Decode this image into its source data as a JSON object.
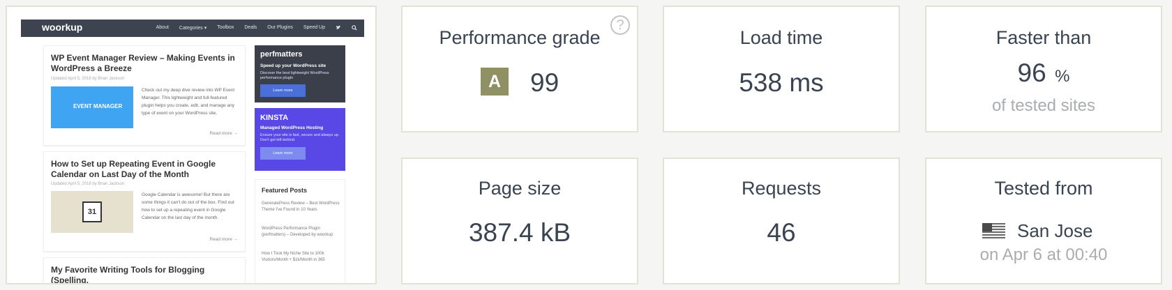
{
  "screenshot": {
    "logo": "woorkup",
    "nav": [
      "About",
      "Categories ▾",
      "Toolbox",
      "Deals",
      "Our Plugins",
      "Speed Up"
    ],
    "posts": [
      {
        "title": "WP Event Manager Review – Making Events in WordPress a Breeze",
        "meta": "Updated April 5, 2018 by Brian Jackson",
        "image_label": "EVENT MANAGER",
        "excerpt": "Check out my deep dive review into WP Event Manager. This lightweight and full-featured plugin helps you create, edit, and manage any type of event on your WordPress site.",
        "read_more": "Read more →"
      },
      {
        "title": "How to Set up Repeating Event in Google Calendar on Last Day of the Month",
        "meta": "Updated April 5, 2018 by Brian Jackson",
        "image_label": "31",
        "excerpt": "Google Calendar is awesome! But there are some things it can't do out of the box. Find out how to set up a repeating event in Google Calendar on the last day of the month.",
        "read_more": "Read more →"
      },
      {
        "title": "My Favorite Writing Tools for Blogging (Spelling,"
      }
    ],
    "ads": [
      {
        "title": "perfmatters",
        "headline": "Speed up your WordPress site",
        "sub": "Discover the best lightweight WordPress performance plugin",
        "button": "Learn more",
        "bg": "#3b3f4a",
        "btn_bg": "#4a6fd8"
      },
      {
        "title": "KINSTA",
        "headline": "Managed WordPress Hosting",
        "sub": "Ensure your site is fast, secure and always up. Don't get left behind.",
        "button": "Learn more",
        "bg": "#5a48e6",
        "btn_bg": "#7d8bf0"
      }
    ],
    "featured": {
      "heading": "Featured Posts",
      "items": [
        "GeneratePress Review – Best WordPress Theme I've Found in 10 Years",
        "WordPress Performance Plugin (perfmatters) – Developed by woorkup",
        "How I Took My Niche Site to 100k Visitors/Month + $1k/Month in 365"
      ]
    }
  },
  "metrics": {
    "performance": {
      "title": "Performance grade",
      "grade": "A",
      "score": "99",
      "help": "?"
    },
    "load_time": {
      "title": "Load time",
      "value": "538 ms"
    },
    "faster_than": {
      "title": "Faster than",
      "value": "96",
      "unit": "%",
      "caption": "of tested sites"
    },
    "page_size": {
      "title": "Page size",
      "value": "387.4 kB"
    },
    "requests": {
      "title": "Requests",
      "value": "46"
    },
    "tested_from": {
      "title": "Tested from",
      "location": "San Jose",
      "when": "on Apr 6 at 00:40"
    }
  },
  "colors": {
    "grade_badge": "#8f9064",
    "text": "#3a4350",
    "muted": "#a9adb1",
    "card_border": "#e3e2d6"
  }
}
